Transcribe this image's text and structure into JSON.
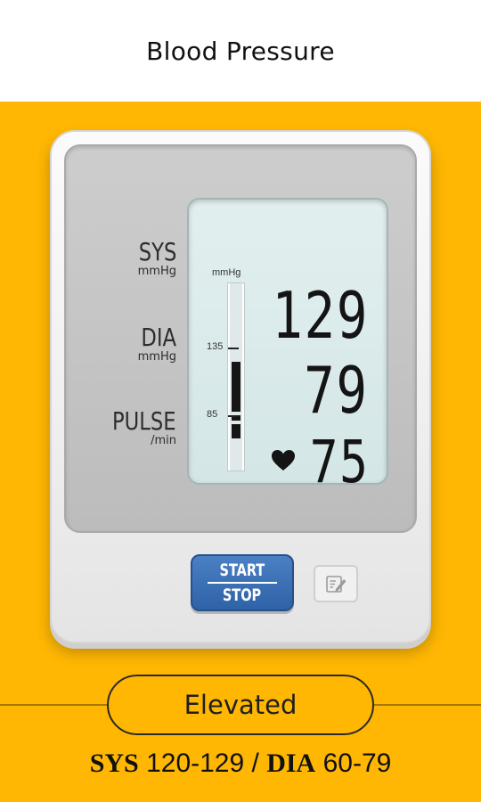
{
  "header": {
    "title": "Blood Pressure"
  },
  "monitor": {
    "sys_label": "SYS",
    "sys_unit": "mmHg",
    "dia_label": "DIA",
    "dia_unit": "mmHg",
    "pulse_label": "PULSE",
    "pulse_unit": "/min",
    "bar_unit": "mmHg",
    "bar_tick_high": "135",
    "bar_tick_low": "85",
    "sys_value": "129",
    "dia_value": "79",
    "pulse_value": "75",
    "heart_icon": "heart-icon"
  },
  "controls": {
    "start_label": "START",
    "stop_label": "STOP",
    "edit_icon": "edit-icon"
  },
  "status": {
    "category": "Elevated",
    "sys_key": "SYS",
    "sys_range": "120-129",
    "separator": "/",
    "dia_key": "DIA",
    "dia_range": "60-79"
  },
  "colors": {
    "background": "#FFB703",
    "button": "#2f62a7",
    "lcd": "#d8e9e9"
  }
}
